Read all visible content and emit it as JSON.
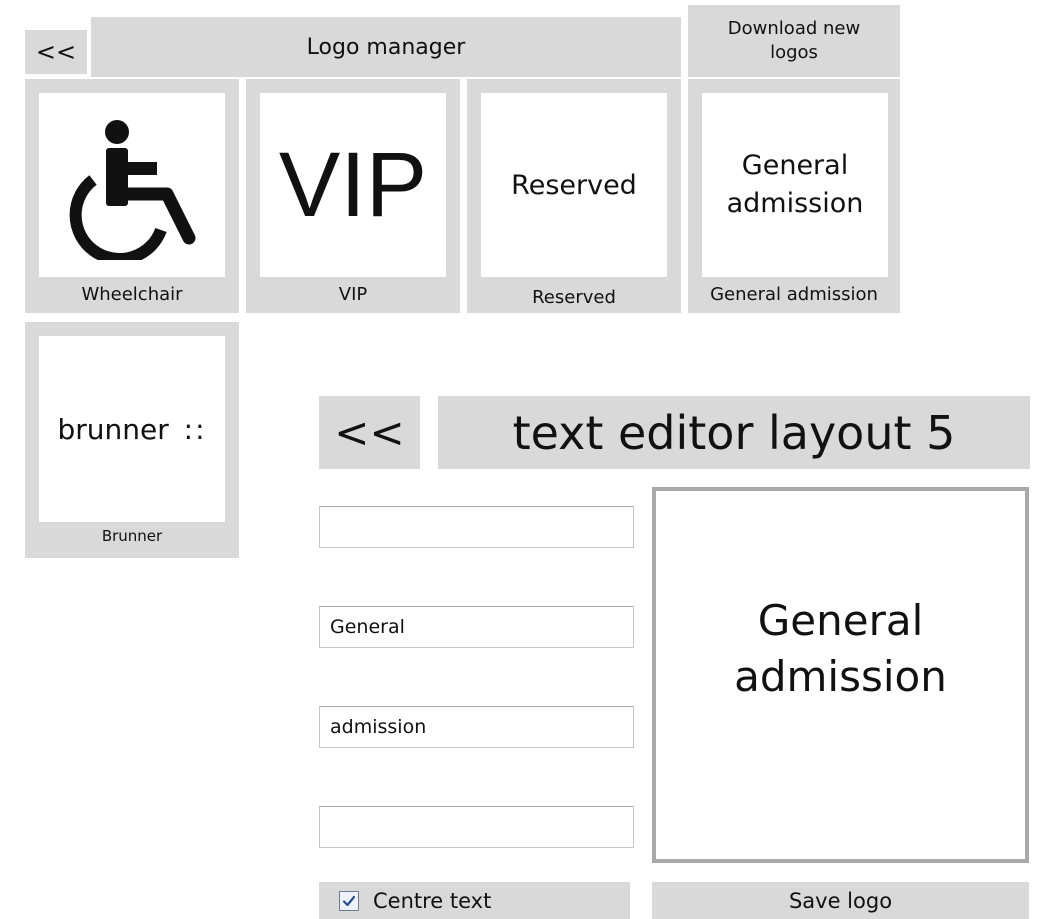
{
  "logo_manager": {
    "back_label": "<<",
    "title": "Logo manager",
    "download_label": "Download new logos",
    "tiles": [
      {
        "label": "Wheelchair",
        "icon": "wheelchair-icon"
      },
      {
        "label": "VIP",
        "preview": "VIP"
      },
      {
        "label": "Reserved",
        "preview": "Reserved"
      },
      {
        "label": "General admission",
        "preview_line1": "General",
        "preview_line2": "admission"
      },
      {
        "label": "Brunner",
        "preview": "brunner",
        "preview_mark": "::"
      }
    ]
  },
  "text_editor": {
    "back_label": "<<",
    "title": "text editor layout 5",
    "fields": [
      {
        "value": ""
      },
      {
        "value": "General"
      },
      {
        "value": "admission"
      },
      {
        "value": ""
      }
    ],
    "preview_line1": "General",
    "preview_line2": "admission",
    "centre_text_label": "Centre text",
    "centre_text_checked": true,
    "save_label": "Save logo"
  }
}
